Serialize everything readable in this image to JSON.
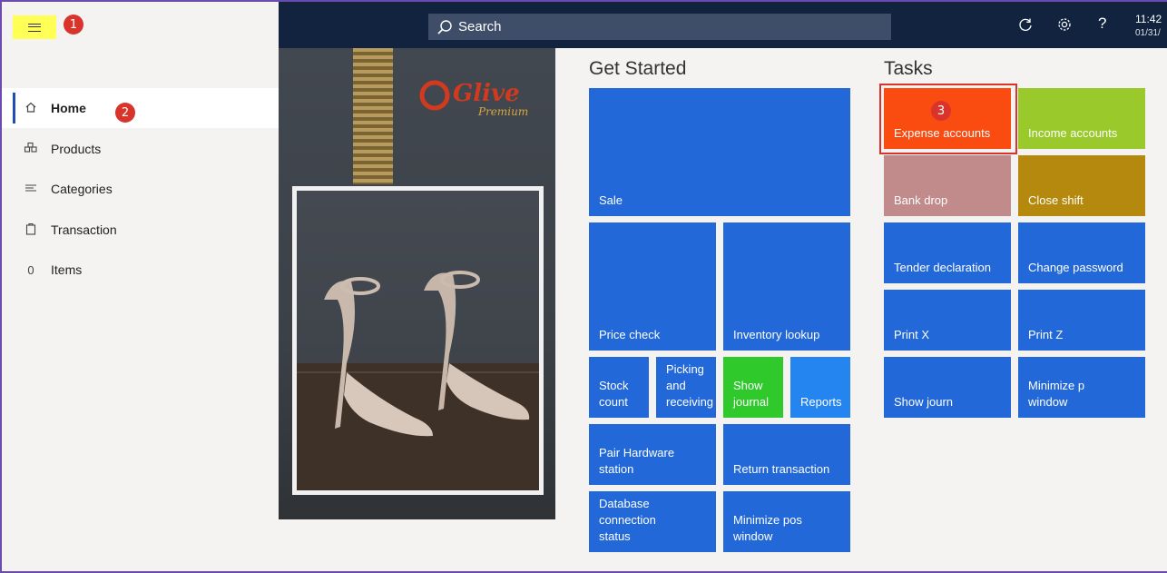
{
  "callouts": {
    "one": "1",
    "two": "2",
    "three": "3"
  },
  "sidebar": {
    "items": [
      {
        "label": "Home",
        "icon": "home-icon",
        "active": true
      },
      {
        "label": "Products",
        "icon": "products-icon"
      },
      {
        "label": "Categories",
        "icon": "categories-icon"
      },
      {
        "label": "Transaction",
        "icon": "transaction-icon"
      },
      {
        "label": "Items",
        "count": "0"
      }
    ]
  },
  "topbar": {
    "search_placeholder": "Search",
    "time": "11:42",
    "date": "01/31/",
    "help": "?"
  },
  "hero": {
    "logo_text": "Glive",
    "logo_sub": "Premium"
  },
  "get_started": {
    "title": "Get Started",
    "tiles": {
      "sale": "Sale",
      "price_check": "Price check",
      "inventory_lookup": "Inventory lookup",
      "stock_count_1": "Stock",
      "stock_count_2": "count",
      "picking_1": "Picking",
      "picking_2": "and",
      "picking_3": "receiving",
      "show_journal_1": "Show",
      "show_journal_2": "journal",
      "reports": "Reports",
      "pair_hw_1": "Pair Hardware",
      "pair_hw_2": "station",
      "return_transaction": "Return transaction",
      "db_conn_1": "Database connection",
      "db_conn_2": "status",
      "min_pos_1": "Minimize pos",
      "min_pos_2": "window"
    }
  },
  "tasks": {
    "title": "Tasks",
    "tiles": {
      "expense_accounts": "Expense accounts",
      "income_accounts": "Income accounts",
      "bank_drop": "Bank drop",
      "close_shift": "Close shift",
      "tender_declaration": "Tender declaration",
      "change_password": "Change password",
      "print_x": "Print X",
      "print_z": "Print Z",
      "show_journ": "Show journ",
      "minimize_p_1": "Minimize p",
      "minimize_p_2": "window"
    }
  },
  "colors": {
    "topbar": "#11233f",
    "tile_blue": "#2268d8",
    "tile_green": "#2fc92b",
    "tile_orange": "#fa4b10",
    "tile_lime": "#99c92a",
    "tile_rose": "#c08b8a",
    "tile_gold": "#b5890d",
    "callout_red": "#d9342b",
    "highlight_yellow": "#ffff55"
  }
}
